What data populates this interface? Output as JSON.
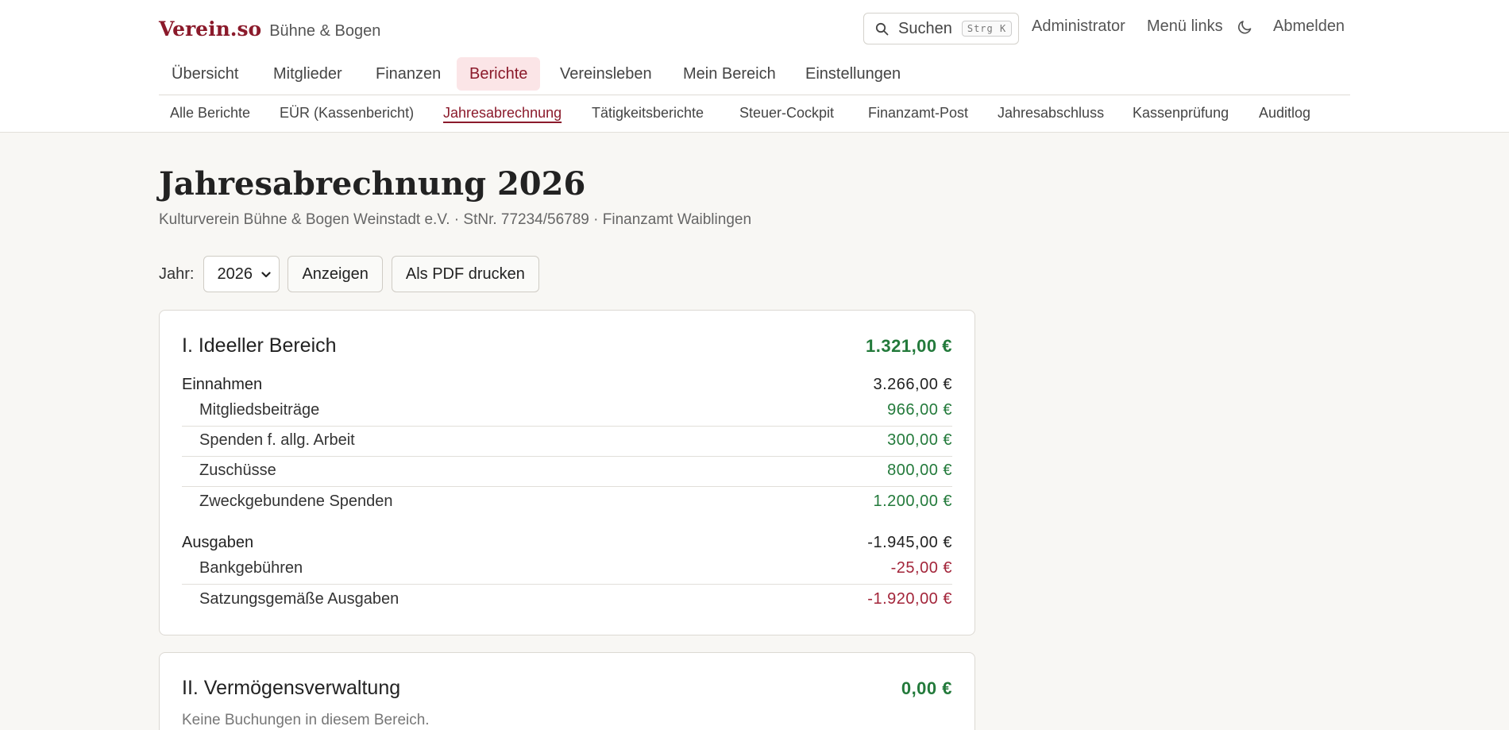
{
  "brand": {
    "logo": "Verein.so",
    "club": "Bühne & Bogen"
  },
  "topbar": {
    "search_label": "Suchen",
    "search_shortcut": "Strg K",
    "links": [
      "Administrator",
      "Menü links",
      "Abmelden"
    ]
  },
  "main_nav": [
    "Übersicht",
    "Mitglieder",
    "Finanzen",
    "Berichte",
    "Vereinsleben",
    "Mein Bereich",
    "Einstellungen"
  ],
  "main_nav_active": "Berichte",
  "sub_nav": [
    "Alle Berichte",
    "EÜR (Kassenbericht)",
    "Jahresabrechnung",
    "Tätigkeitsberichte",
    "Steuer-Cockpit",
    "Finanzamt-Post",
    "Jahresabschluss",
    "Kassenprüfung",
    "Auditlog"
  ],
  "sub_nav_active": "Jahresabrechnung",
  "page": {
    "title": "Jahresabrechnung 2026",
    "subtitle": "Kulturverein Bühne & Bogen Weinstadt e.V. · StNr. 77234/56789 · Finanzamt Waiblingen"
  },
  "filter": {
    "label": "Jahr:",
    "year_selected": "2026",
    "show_button": "Anzeigen",
    "pdf_button": "Als PDF drucken"
  },
  "sections": [
    {
      "title": "I. Ideeller Bereich",
      "total": "1.321,00 €",
      "income": {
        "label": "Einnahmen",
        "sum": "3.266,00 €",
        "items": [
          {
            "label": "Mitgliedsbeiträge",
            "amount": "966,00 €"
          },
          {
            "label": "Spenden f. allg. Arbeit",
            "amount": "300,00 €"
          },
          {
            "label": "Zuschüsse",
            "amount": "800,00 €"
          },
          {
            "label": "Zweckgebundene Spenden",
            "amount": "1.200,00 €"
          }
        ]
      },
      "expenses": {
        "label": "Ausgaben",
        "sum": "-1.945,00 €",
        "items": [
          {
            "label": "Bankgebühren",
            "amount": "-25,00 €"
          },
          {
            "label": "Satzungsgemäße Ausgaben",
            "amount": "-1.920,00 €"
          }
        ]
      }
    },
    {
      "title": "II. Vermögensverwaltung",
      "total": "0,00 €",
      "empty_note": "Keine Buchungen in diesem Bereich."
    }
  ],
  "colors": {
    "brand": "#8b1a2b",
    "positive": "#237a3b",
    "negative": "#a3253a",
    "active_tab_bg": "#fbe5e7"
  }
}
